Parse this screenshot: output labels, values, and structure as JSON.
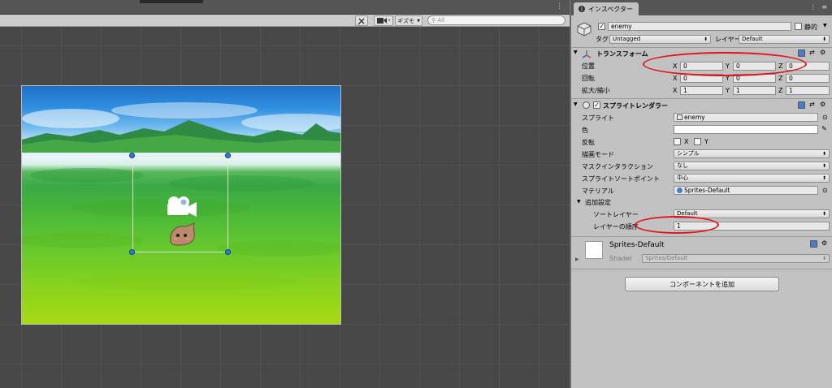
{
  "scene": {
    "search_placeholder": "All",
    "gizmos_label": "ギズモ",
    "kebab": "⋮"
  },
  "inspector": {
    "tab_label": "インスペクター",
    "window_controls": "⋮ ≡",
    "object": {
      "name": "enemy",
      "static_label": "静的",
      "tag_label": "タグ",
      "tag_value": "Untagged",
      "layer_label": "レイヤー",
      "layer_value": "Default"
    },
    "transform": {
      "title": "トランスフォーム",
      "position_label": "位置",
      "rotation_label": "回転",
      "scale_label": "拡大/縮小",
      "position": {
        "x": "0",
        "y": "0",
        "z": "0"
      },
      "rotation": {
        "x": "0",
        "y": "0",
        "z": "0"
      },
      "scale": {
        "x": "1",
        "y": "1",
        "z": "1"
      },
      "axis_x": "X",
      "axis_y": "Y",
      "axis_z": "Z"
    },
    "sprite_renderer": {
      "title": "スプライトレンダラー",
      "sprite_label": "スプライト",
      "sprite_value": "enemy",
      "color_label": "色",
      "flip_label": "反転",
      "flip_x": "X",
      "flip_y": "Y",
      "draw_mode_label": "描画モード",
      "draw_mode_value": "シンプル",
      "mask_label": "マスクインタラクション",
      "mask_value": "なし",
      "sort_point_label": "スプライトソートポイント",
      "sort_point_value": "中心",
      "material_label": "マテリアル",
      "material_value": "Sprites-Default",
      "additional_label": "追加設定",
      "sorting_layer_label": "ソートレイヤー",
      "sorting_layer_value": "Default",
      "order_label": "レイヤーの順序",
      "order_value": "1"
    },
    "material_block": {
      "name": "Sprites-Default",
      "shader_label": "Shader",
      "shader_value": "Sprites/Default"
    },
    "add_component_label": "コンポーネントを追加"
  },
  "colors": {
    "annotation_red": "#e0141b",
    "handle_blue": "#2d7fd9"
  }
}
